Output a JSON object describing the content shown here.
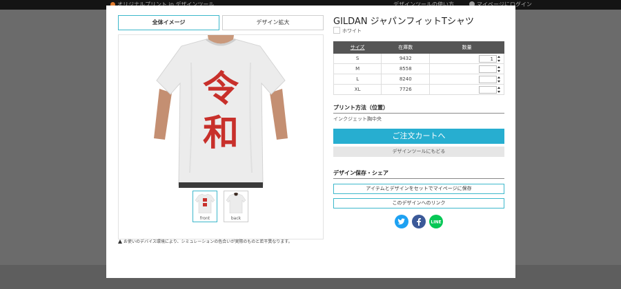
{
  "topbar": {
    "site_text": "オリジナルプリント.jp デザインツール",
    "nav_text": "デザインツールの使い方",
    "user_text": "マイページにログイン"
  },
  "tabs": {
    "full": "全体イメージ",
    "zoom": "デザイン拡大"
  },
  "preview": {
    "print_text": [
      "令",
      "和"
    ],
    "thumbs": [
      {
        "label": "front"
      },
      {
        "label": "back"
      }
    ],
    "notice": "お使いのデバイス環境により、シミュレーションの色合いが実際のものと若干異なります。"
  },
  "product": {
    "title": "GILDAN ジャパンフィットTシャツ",
    "color_name": "ホワイト",
    "table": {
      "headers": [
        "サイズ",
        "在庫数",
        "数量"
      ],
      "rows": [
        {
          "size": "S",
          "stock": "9432",
          "qty": "1"
        },
        {
          "size": "M",
          "stock": "8558",
          "qty": ""
        },
        {
          "size": "L",
          "stock": "8240",
          "qty": ""
        },
        {
          "size": "XL",
          "stock": "7726",
          "qty": ""
        }
      ]
    },
    "print_method_heading": "プリント方法（位置）",
    "print_method_value": "インクジェット胸中央",
    "cart_button": "ご注文カートへ",
    "back_button": "デザインツールにもどる",
    "save_heading": "デザイン保存・シェア",
    "save_button": "アイテムとデザインをセットでマイページに保存",
    "link_button": "このデザインへのリンク"
  },
  "share": {
    "line_label": "LINE",
    "icons": [
      "twitter-icon",
      "facebook-icon",
      "line-icon"
    ]
  },
  "colors": {
    "accent": "#27aed0",
    "print_red": "#c8302b",
    "header_bg": "#555555"
  }
}
